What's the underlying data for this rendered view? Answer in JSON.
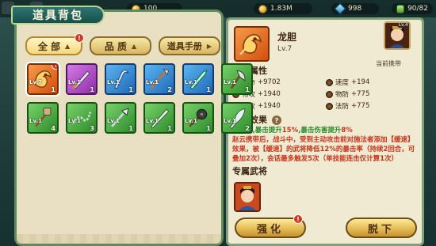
{
  "topbar": {
    "res1": "100",
    "res2": "1.83M",
    "res3": "998",
    "bag_count": "90/82"
  },
  "panel_title": "道具背包",
  "tabs": [
    {
      "label": "全 部",
      "badge": "!"
    },
    {
      "label": "品 质"
    },
    {
      "label": "道具手册"
    }
  ],
  "items": [
    {
      "rarity": "orange",
      "icon": "dragon-gall-icon",
      "lv": "Lv.7",
      "count": "1",
      "badge": "!",
      "selected": true
    },
    {
      "rarity": "purple",
      "icon": "sword-icon",
      "lv": "Lv.1",
      "count": "1"
    },
    {
      "rarity": "blue",
      "icon": "hook-blade-icon",
      "lv": "Lv.1",
      "count": "1"
    },
    {
      "rarity": "blue",
      "icon": "spear-icon",
      "lv": "Lv.1",
      "count": "2"
    },
    {
      "rarity": "blue",
      "icon": "jade-sword-icon",
      "lv": "Lv.1",
      "count": "1"
    },
    {
      "rarity": "green",
      "icon": "axe-icon",
      "lv": "Lv.1",
      "count": "1"
    },
    {
      "rarity": "green",
      "icon": "hammer-icon",
      "lv": "Lv.1",
      "count": "4"
    },
    {
      "rarity": "green",
      "icon": "chain-whip-icon",
      "lv": "Lv.1",
      "count": "3"
    },
    {
      "rarity": "green",
      "icon": "flail-icon",
      "lv": "Lv.1",
      "count": "1"
    },
    {
      "rarity": "green",
      "icon": "blade-icon",
      "lv": "Lv.1",
      "count": "1"
    },
    {
      "rarity": "green",
      "icon": "morning-star-icon",
      "lv": "Lv.1",
      "count": "1"
    },
    {
      "rarity": "green",
      "icon": "broadsword-icon",
      "lv": "Lv.1",
      "count": "2"
    }
  ],
  "detail": {
    "name": "龙胆",
    "lv": "Lv.7",
    "carrier_label": "当前携带",
    "carrier_lv": "Lv.4",
    "basic_attr_title": "基础属性",
    "attrs": [
      {
        "label": "生命",
        "value": "+9702"
      },
      {
        "label": "速度",
        "value": "+194"
      },
      {
        "label": "物攻",
        "value": "+1940"
      },
      {
        "label": "物防",
        "value": "+775"
      },
      {
        "label": "法攻",
        "value": "+1940"
      },
      {
        "label": "法防",
        "value": "+775"
      }
    ],
    "effect_title": "携带效果",
    "effect_line1a": "携带后,暴击提升",
    "effect_line1b": "15%",
    "effect_line1c": ",暴击伤害提升",
    "effect_line1d": "8%",
    "effect_line2": "赵云携带后，战斗中，受到主动攻击前对施法者添加【缓速】效果，被【缓速】的武将降低12%的暴击率（持续2回合，可叠加2次），会话最多触发5次（单技能连击仅计算1次）",
    "exclusive_title": "专属武将"
  },
  "buttons": {
    "upgrade": "强化",
    "upgrade_badge": "!",
    "unequip": "脱下"
  }
}
